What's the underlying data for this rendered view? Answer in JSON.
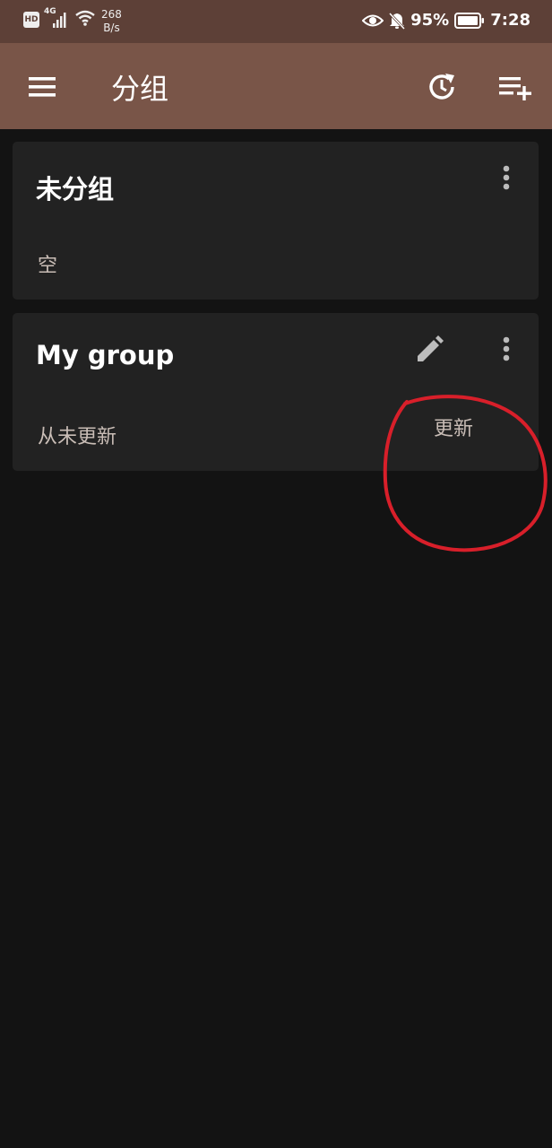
{
  "status_bar": {
    "hd_label": "HD",
    "network_label": "4G",
    "speed_value": "268",
    "speed_unit": "B/s",
    "battery": "95%",
    "time": "7:28"
  },
  "toolbar": {
    "title": "分组",
    "menu_icon": "hamburger-menu-icon",
    "refresh_icon": "refresh-clock-icon",
    "add_icon": "playlist-add-icon"
  },
  "groups": [
    {
      "title": "未分组",
      "subtitle": "空"
    },
    {
      "title": "My group",
      "subtitle": "从未更新",
      "update_label": "更新"
    }
  ],
  "colors": {
    "status_bar": "#5d4037",
    "toolbar": "#795548",
    "background": "#131313",
    "card": "#222222",
    "secondary_text": "#c9bdb6",
    "annotation": "#d81f2a"
  }
}
